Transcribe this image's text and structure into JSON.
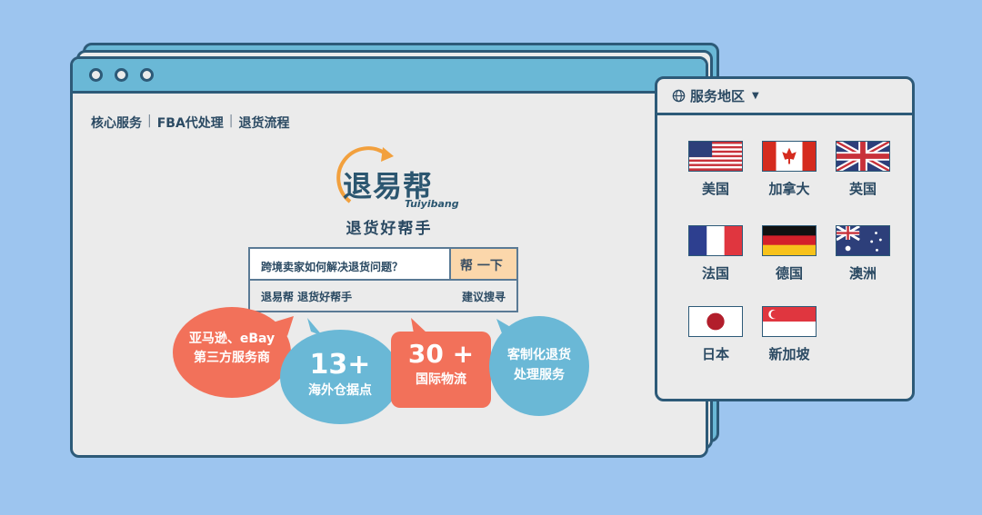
{
  "nav": {
    "items": [
      "核心服务",
      "FBA代处理",
      "退货流程"
    ],
    "sep": "|"
  },
  "logo": {
    "name": "退易帮",
    "pinyin": "Tuiyibang"
  },
  "slogan": "退货好帮手",
  "search": {
    "query": "跨境卖家如何解决退货问题？",
    "button": "帮 一下",
    "suggestion": "退易帮 退货好帮手",
    "suggestion_label": "建议搜寻"
  },
  "bubbles": [
    {
      "line1": "亚马逊、eBay",
      "line2": "第三方服务商"
    },
    {
      "big": "13+",
      "line2": "海外仓据点"
    },
    {
      "big": "30 +",
      "line2": "国际物流"
    },
    {
      "line1": "客制化退货",
      "line2": "处理服务"
    }
  ],
  "panel": {
    "title": "服务地区",
    "arrow": "▼",
    "countries": [
      "美国",
      "加拿大",
      "英国",
      "法国",
      "德国",
      "澳洲",
      "日本",
      "新加坡"
    ]
  },
  "colors": {
    "background": "#9dc5ef",
    "titlebar": "#6ab8d6",
    "border": "#2d5a78",
    "coral": "#f2715a",
    "blue": "#6ab8d6",
    "button": "#fbd7ab",
    "orange": "#f2a03d"
  }
}
